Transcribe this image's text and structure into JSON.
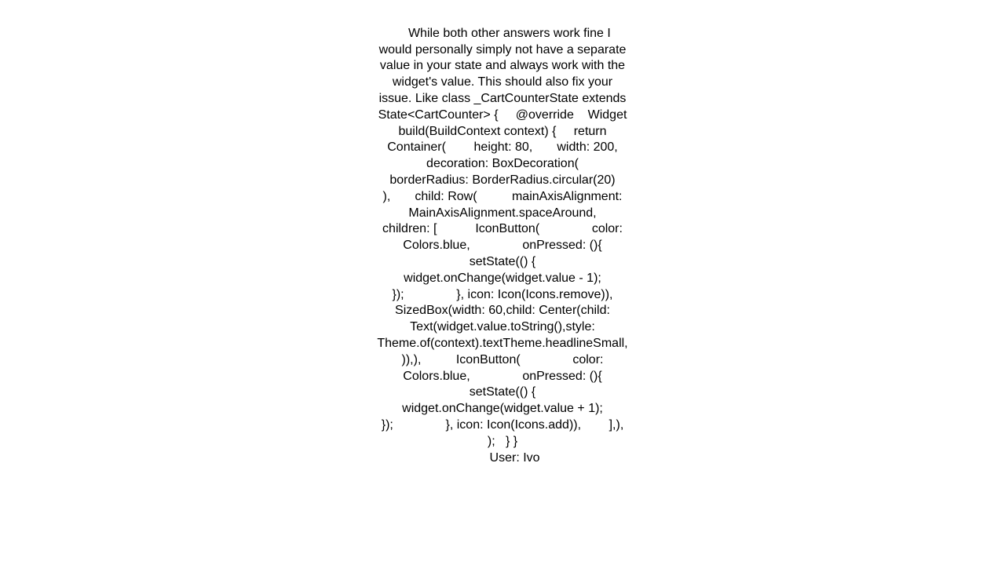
{
  "answer": {
    "body": "While both other answers work fine I would personally simply not have a separate value in your state and always work with the widget's value. This should also fix your issue. Like class _CartCounterState extends State<CartCounter> {     @override    Widget build(BuildContext context) {     return Container(        height: 80,       width: 200,        decoration: BoxDecoration(           borderRadius: BorderRadius.circular(20)        ),       child: Row(          mainAxisAlignment: MainAxisAlignment.spaceAround,         children: [           IconButton(               color: Colors.blue,               onPressed: (){                 setState(() {                   widget.onChange(widget.value - 1);                 });               }, icon: Icon(Icons.remove)),           SizedBox(width: 60,child: Center(child: Text(widget.value.toString(),style: Theme.of(context).textTheme.headlineSmall,)),),          IconButton(               color: Colors.blue,               onPressed: (){                 setState(() {                   widget.onChange(widget.value + 1);                 });               }, icon: Icon(Icons.add)),        ],),     );   } }",
    "user_label": "User:",
    "user_name": "Ivo"
  }
}
